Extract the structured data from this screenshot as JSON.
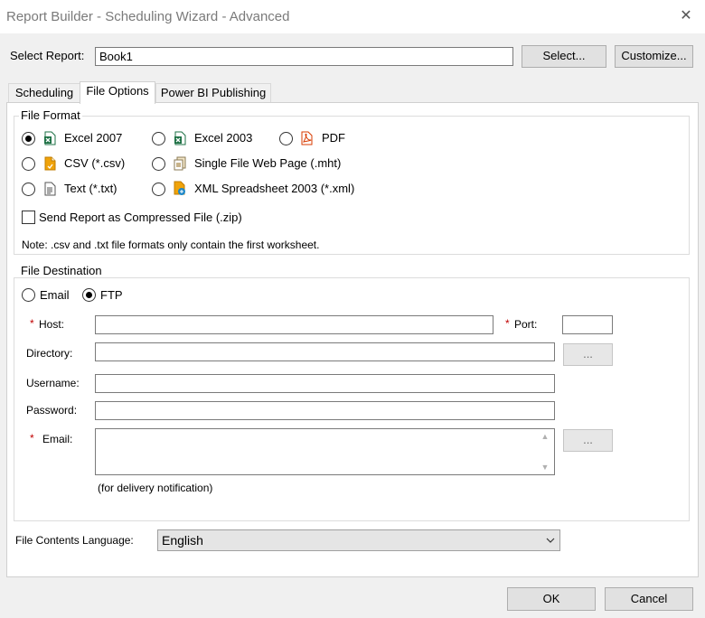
{
  "window": {
    "title": "Report Builder - Scheduling Wizard - Advanced",
    "close_glyph": "✕"
  },
  "report": {
    "label": "Select Report:",
    "value": "Book1",
    "select_button": "Select...",
    "customize_button": "Customize..."
  },
  "tabs": [
    {
      "label": "Scheduling",
      "active": false
    },
    {
      "label": "File Options",
      "active": true
    },
    {
      "label": "Power BI Publishing",
      "active": false
    }
  ],
  "file_format": {
    "legend": "File Format",
    "options": [
      {
        "label": "Excel 2007",
        "selected": true,
        "icon": "excel-icon"
      },
      {
        "label": "Excel 2003",
        "selected": false,
        "icon": "excel-icon"
      },
      {
        "label": "PDF",
        "selected": false,
        "icon": "pdf-icon"
      },
      {
        "label": "CSV (*.csv)",
        "selected": false,
        "icon": "csv-file-icon"
      },
      {
        "label": "Single File Web Page (.mht)",
        "selected": false,
        "icon": "web-page-icon"
      },
      {
        "label": "Text (*.txt)",
        "selected": false,
        "icon": "text-file-icon"
      },
      {
        "label": "XML Spreadsheet 2003 (*.xml)",
        "selected": false,
        "icon": "xml-file-icon"
      }
    ],
    "compress_label": "Send Report as Compressed File (.zip)",
    "compress_checked": false,
    "note": "Note: .csv and .txt file formats only contain the first worksheet."
  },
  "file_destination": {
    "legend": "File Destination",
    "email_radio": "Email",
    "ftp_radio": "FTP",
    "selected": "FTP",
    "required_mark": "*",
    "host_label": "Host:",
    "host_value": "",
    "port_label": "Port:",
    "port_value": "",
    "directory_label": "Directory:",
    "directory_value": "",
    "browse_label": "...",
    "username_label": "Username:",
    "username_value": "",
    "password_label": "Password:",
    "password_value": "",
    "email_label": "Email:",
    "email_value": "",
    "email_browse_label": "...",
    "email_hint": "(for delivery notification)"
  },
  "language": {
    "label": "File Contents Language:",
    "value": "English"
  },
  "buttons": {
    "ok": "OK",
    "cancel": "Cancel"
  },
  "colors": {
    "excel": "#1e7145",
    "pdf": "#d83b01",
    "csv": "#f0a30a",
    "accent_required": "#c00000"
  }
}
